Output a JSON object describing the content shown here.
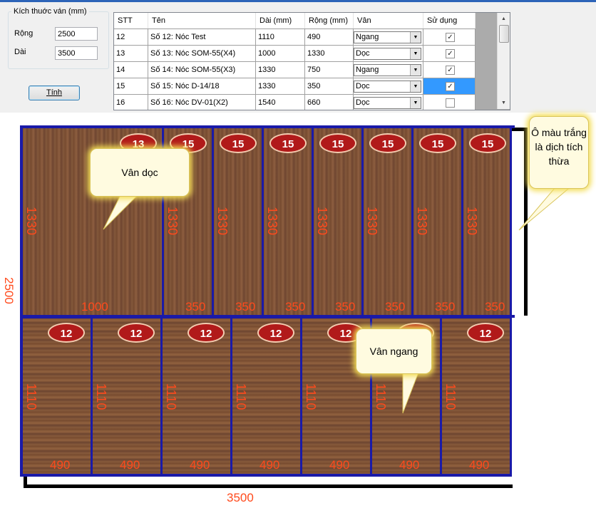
{
  "form": {
    "group_title": "Kích thuớc ván (mm)",
    "rong_label": "Rộng",
    "rong_value": "2500",
    "dai_label": "Dài",
    "dai_value": "3500",
    "calc_button": "Tính"
  },
  "grid": {
    "columns": [
      "STT",
      "Tên",
      "Dài  (mm)",
      "Rộng (mm)",
      "Vân",
      "Sử dụng"
    ],
    "rows": [
      {
        "stt": "12",
        "ten": "Số 12: Nóc Test",
        "dai": "1110",
        "rong": "490",
        "van": "Ngang",
        "used": true
      },
      {
        "stt": "13",
        "ten": "Số 13: Nóc SOM-55(X4)",
        "dai": "1000",
        "rong": "1330",
        "van": "Dọc",
        "used": true
      },
      {
        "stt": "14",
        "ten": "Số 14: Nóc SOM-55(X3)",
        "dai": "1330",
        "rong": "750",
        "van": "Ngang",
        "used": true
      },
      {
        "stt": "15",
        "ten": "Số 15: Nóc D-14/18",
        "dai": "1330",
        "rong": "350",
        "van": "Dọc",
        "used": true
      },
      {
        "stt": "16",
        "ten": "Số 16: Nóc DV-01(X2)",
        "dai": "1540",
        "rong": "660",
        "van": "Dọc",
        "used": false
      }
    ]
  },
  "layout": {
    "sheet_width_label": "3500",
    "sheet_height_label": "2500",
    "top_row": [
      {
        "id": "13",
        "length": "1330",
        "width": "1000"
      },
      {
        "id": "15",
        "length": "1330",
        "width": "350"
      },
      {
        "id": "15",
        "length": "1330",
        "width": "350"
      },
      {
        "id": "15",
        "length": "1330",
        "width": "350"
      },
      {
        "id": "15",
        "length": "1330",
        "width": "350"
      },
      {
        "id": "15",
        "length": "1330",
        "width": "350"
      },
      {
        "id": "15",
        "length": "1330",
        "width": "350"
      },
      {
        "id": "15",
        "length": "1330",
        "width": "350"
      }
    ],
    "bottom_row": [
      {
        "id": "12",
        "length": "1110",
        "width": "490"
      },
      {
        "id": "12",
        "length": "1110",
        "width": "490"
      },
      {
        "id": "12",
        "length": "1110",
        "width": "490"
      },
      {
        "id": "12",
        "length": "1110",
        "width": "490"
      },
      {
        "id": "12",
        "length": "1110",
        "width": "490"
      },
      {
        "id": "12",
        "length": "1110",
        "width": "490"
      },
      {
        "id": "12",
        "length": "1110",
        "width": "490"
      }
    ]
  },
  "callouts": {
    "van_doc": "Vân dọc",
    "van_ngang": "Vân ngang",
    "waste_note": "Ô màu trắng là dịch tích thừa"
  }
}
